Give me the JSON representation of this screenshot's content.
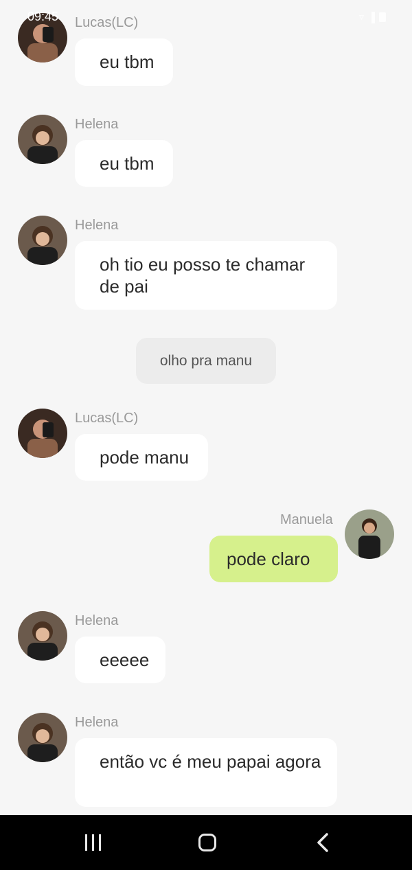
{
  "status_bar": {
    "time": "09:45",
    "icons": [
      "wifi-icon",
      "signal-icon",
      "battery-icon"
    ]
  },
  "colors": {
    "background": "#f6f6f6",
    "incoming_bubble": "#ffffff",
    "outgoing_bubble": "#d6f08c",
    "system_bubble": "#ececec",
    "sender_name": "#9a9a9a",
    "navbar": "#000000"
  },
  "messages": [
    {
      "sender": "Lucas(LC)",
      "text": "eu tbm",
      "side": "left"
    },
    {
      "sender": "Helena",
      "text": "eu tbm",
      "side": "left"
    },
    {
      "sender": "Helena",
      "text": "oh tio eu posso te chamar de pai",
      "side": "left"
    },
    {
      "type": "system",
      "text": "olho pra manu"
    },
    {
      "sender": "Lucas(LC)",
      "text": "pode manu",
      "side": "left"
    },
    {
      "sender": "Manuela",
      "text": "pode claro",
      "side": "right"
    },
    {
      "sender": "Helena",
      "text": "eeeee",
      "side": "left"
    },
    {
      "sender": "Helena",
      "text": "então vc é meu papai agora",
      "side": "left"
    }
  ],
  "navbar": {
    "buttons": [
      "recent-apps-icon",
      "home-icon",
      "back-icon"
    ]
  }
}
